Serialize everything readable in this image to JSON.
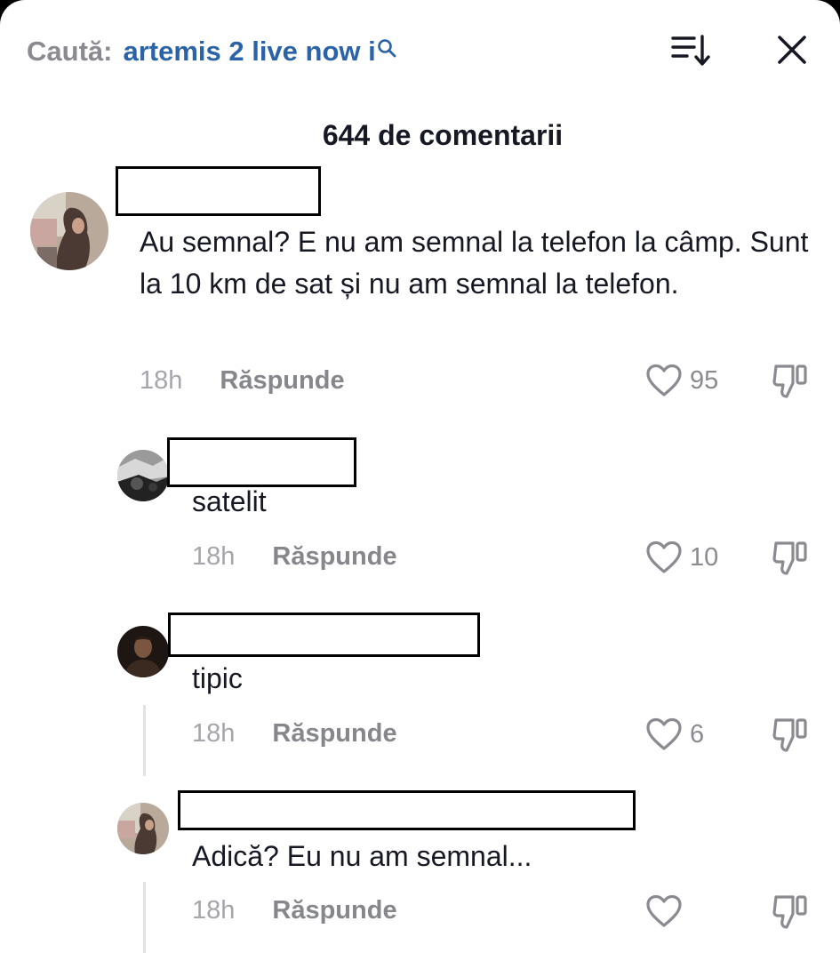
{
  "header": {
    "search_prefix": "Caută:",
    "search_query": "artemis 2 live now i",
    "search_icon": "search-icon",
    "sort_icon": "sort-icon",
    "close_icon": "close-icon",
    "comment_count": "644 de comentarii"
  },
  "comments": [
    {
      "text": "Au semnal? E nu am semnal la telefon la câmp. Sunt la 10 km de sat și nu am semnal la telefon.",
      "time": "18h",
      "reply_label": "Răspunde",
      "likes": "95"
    },
    {
      "text": "satelit",
      "time": "18h",
      "reply_label": "Răspunde",
      "likes": "10"
    },
    {
      "text": "tipic",
      "time": "18h",
      "reply_label": "Răspunde",
      "likes": "6"
    },
    {
      "text": "Adică? Eu nu am semnal...",
      "time": "18h",
      "reply_label": "Răspunde",
      "likes": ""
    }
  ],
  "colors": {
    "query_blue": "#2b63a8",
    "muted_gray": "#8a8b91",
    "text_dark": "#161823"
  }
}
